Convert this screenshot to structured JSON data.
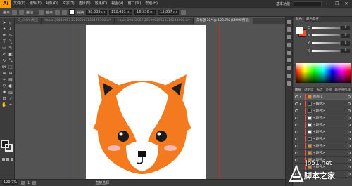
{
  "app": {
    "logo": "Ai"
  },
  "menubar": {
    "items": [
      "文件(F)",
      "编辑(E)",
      "对象(O)",
      "文字(T)",
      "选择(S)",
      "效果(C)",
      "视图(V)",
      "窗口(W)",
      "帮助(H)"
    ],
    "workspace": "基本功能",
    "window_controls": [
      "—",
      "❐",
      "✕"
    ]
  },
  "controlbar": {
    "left_label": "描点",
    "stroke_label": "描边：",
    "anchor_label": "锚点",
    "transform_label": "变换",
    "x_value": "98.333 m",
    "y_value": "112.431 m",
    "w_value": "18.936 m",
    "h_value": "13.837 m"
  },
  "tabs": [
    {
      "label": "2_CMYK/预览"
    },
    {
      "label": "hbpic 29842067 2019091S123476700.ai*"
    },
    {
      "label": "hbpic 29842067 20190919113316244000.ai*"
    },
    {
      "label": "未标题-22* @ 120.7% (CMYK/预览)"
    }
  ],
  "statusbar": {
    "zoom": "120.7%",
    "artboard": "1",
    "label": "直接选择"
  },
  "color_panel": {
    "tabs": [
      "颜色",
      "颜色参考"
    ],
    "sliders": [
      {
        "letter": "C",
        "value": "0"
      },
      {
        "letter": "M",
        "value": "0"
      },
      {
        "letter": "Y",
        "value": "0"
      },
      {
        "letter": "K",
        "value": "0"
      }
    ]
  },
  "layers_panel": {
    "tabs": [
      "图层",
      "透明度",
      "描边",
      "外观",
      "路径查找器"
    ],
    "rows": [
      {
        "name": "图层 1",
        "thumb": "orange"
      },
      {
        "name": "<编组>",
        "thumb": "dark"
      },
      {
        "name": "<路径>",
        "thumb": "dark"
      },
      {
        "name": "<路径>",
        "thumb": "white"
      },
      {
        "name": "<路径>",
        "thumb": "white"
      },
      {
        "name": "<路径>",
        "thumb": "white"
      },
      {
        "name": "<路径>",
        "thumb": "dark"
      },
      {
        "name": "<路径>",
        "thumb": "orange"
      },
      {
        "name": "<路径>",
        "thumb": "orange"
      },
      {
        "name": "<路径>",
        "thumb": "orange"
      },
      {
        "name": "<路径>",
        "thumb": "orange"
      },
      {
        "name": "<路径>",
        "thumb": "white"
      }
    ]
  },
  "watermark": {
    "url": "jb51.net",
    "name": "脚本之家"
  },
  "colors": {
    "fox_orange": "#f47a1f",
    "fox_orange_light": "#f9a23a",
    "fox_white": "#ffffff",
    "guide_red": "#c9302c"
  }
}
